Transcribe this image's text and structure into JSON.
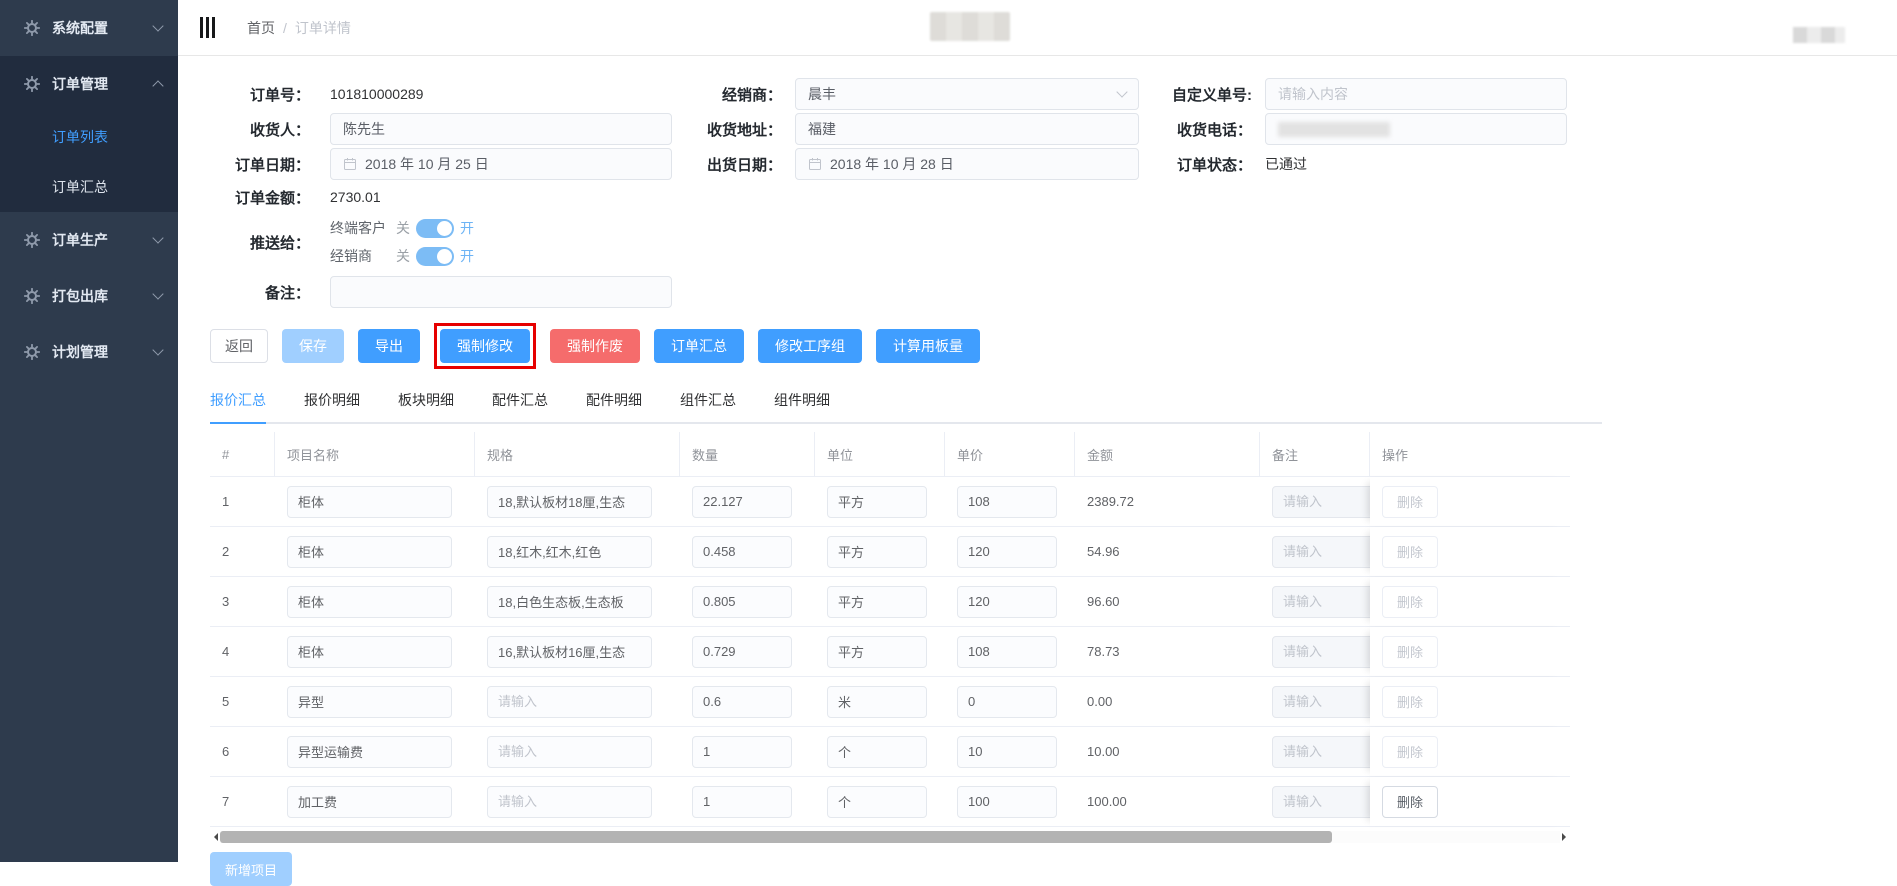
{
  "colors": {
    "accent": "#409eff",
    "accent_disabled": "#a0cfff",
    "danger": "#f56c6c",
    "highlight_red": "#e60000",
    "sidebar_bg": "#2e3b4d",
    "sidebar_group_bg": "#212c3e"
  },
  "sidebar": {
    "items": [
      {
        "label": "系统配置",
        "icon": "gear-icon",
        "state": "collapsed",
        "children": []
      },
      {
        "label": "订单管理",
        "icon": "gear-icon",
        "state": "expanded",
        "children": [
          {
            "label": "订单列表",
            "active": true
          },
          {
            "label": "订单汇总",
            "active": false
          }
        ]
      },
      {
        "label": "订单生产",
        "icon": "gear-icon",
        "state": "collapsed",
        "children": []
      },
      {
        "label": "打包出库",
        "icon": "gear-icon",
        "state": "collapsed",
        "children": []
      },
      {
        "label": "计划管理",
        "icon": "gear-icon",
        "state": "collapsed",
        "children": []
      }
    ]
  },
  "breadcrumb": {
    "home": "首页",
    "separator": "/",
    "current": "订单详情"
  },
  "form": {
    "order_no_label": "订单号：",
    "order_no": "101810000289",
    "dealer_label": "经销商：",
    "dealer_value": "晨丰",
    "custom_no_label": "自定义单号:",
    "custom_no_placeholder": "请输入内容",
    "consignee_label": "收货人：",
    "consignee_value": "陈先生",
    "address_label": "收货地址：",
    "address_value": "福建",
    "phone_label": "收货电话：",
    "order_date_label": "订单日期：",
    "order_date_value": "2018 年 10 月 25 日",
    "ship_date_label": "出货日期：",
    "ship_date_value": "2018 年 10 月 28 日",
    "status_label": "订单状态：",
    "status_value": "已通过",
    "amount_label": "订单金额：",
    "amount_value": "2730.01",
    "push_label": "推送给：",
    "toggles": [
      {
        "name": "终端客户",
        "off_label": "关",
        "on_label": "开",
        "on": true
      },
      {
        "name": "经销商",
        "off_label": "关",
        "on_label": "开",
        "on": true
      }
    ],
    "remark_label": "备注：",
    "remark_value": ""
  },
  "toolbar": {
    "buttons": [
      {
        "label": "返回",
        "style": "plain",
        "highlighted": false
      },
      {
        "label": "保存",
        "style": "light",
        "highlighted": false
      },
      {
        "label": "导出",
        "style": "blue",
        "highlighted": false
      },
      {
        "label": "强制修改",
        "style": "blue",
        "highlighted": true
      },
      {
        "label": "强制作废",
        "style": "red",
        "highlighted": false
      },
      {
        "label": "订单汇总",
        "style": "blue",
        "highlighted": false
      },
      {
        "label": "修改工序组",
        "style": "blue",
        "highlighted": false
      },
      {
        "label": "计算用板量",
        "style": "blue",
        "highlighted": false
      }
    ]
  },
  "tabs": [
    {
      "label": "报价汇总",
      "active": true
    },
    {
      "label": "报价明细",
      "active": false
    },
    {
      "label": "板块明细",
      "active": false
    },
    {
      "label": "配件汇总",
      "active": false
    },
    {
      "label": "配件明细",
      "active": false
    },
    {
      "label": "组件汇总",
      "active": false
    },
    {
      "label": "组件明细",
      "active": false
    }
  ],
  "table": {
    "columns": [
      "#",
      "项目名称",
      "规格",
      "数量",
      "单位",
      "单价",
      "金额",
      "备注",
      "操作"
    ],
    "input_placeholder": "请输入",
    "delete_label": "删除",
    "rows": [
      {
        "no": "1",
        "name": "柜体",
        "spec": "18,默认板材18厘,生态",
        "qty": "22.127",
        "unit": "平方",
        "price": "108",
        "amount": "2389.72",
        "remark": "",
        "delete_enabled": false
      },
      {
        "no": "2",
        "name": "柜体",
        "spec": "18,红木,红木,红色",
        "qty": "0.458",
        "unit": "平方",
        "price": "120",
        "amount": "54.96",
        "remark": "",
        "delete_enabled": false
      },
      {
        "no": "3",
        "name": "柜体",
        "spec": "18,白色生态板,生态板",
        "qty": "0.805",
        "unit": "平方",
        "price": "120",
        "amount": "96.60",
        "remark": "",
        "delete_enabled": false
      },
      {
        "no": "4",
        "name": "柜体",
        "spec": "16,默认板材16厘,生态",
        "qty": "0.729",
        "unit": "平方",
        "price": "108",
        "amount": "78.73",
        "remark": "",
        "delete_enabled": false
      },
      {
        "no": "5",
        "name": "异型",
        "spec": "",
        "qty": "0.6",
        "unit": "米",
        "price": "0",
        "amount": "0.00",
        "remark": "",
        "delete_enabled": false
      },
      {
        "no": "6",
        "name": "异型运输费",
        "spec": "",
        "qty": "1",
        "unit": "个",
        "price": "10",
        "amount": "10.00",
        "remark": "",
        "delete_enabled": false
      },
      {
        "no": "7",
        "name": "加工费",
        "spec": "",
        "qty": "1",
        "unit": "个",
        "price": "100",
        "amount": "100.00",
        "remark": "",
        "delete_enabled": true
      }
    ]
  },
  "footer": {
    "add_button_label": "新增项目"
  }
}
